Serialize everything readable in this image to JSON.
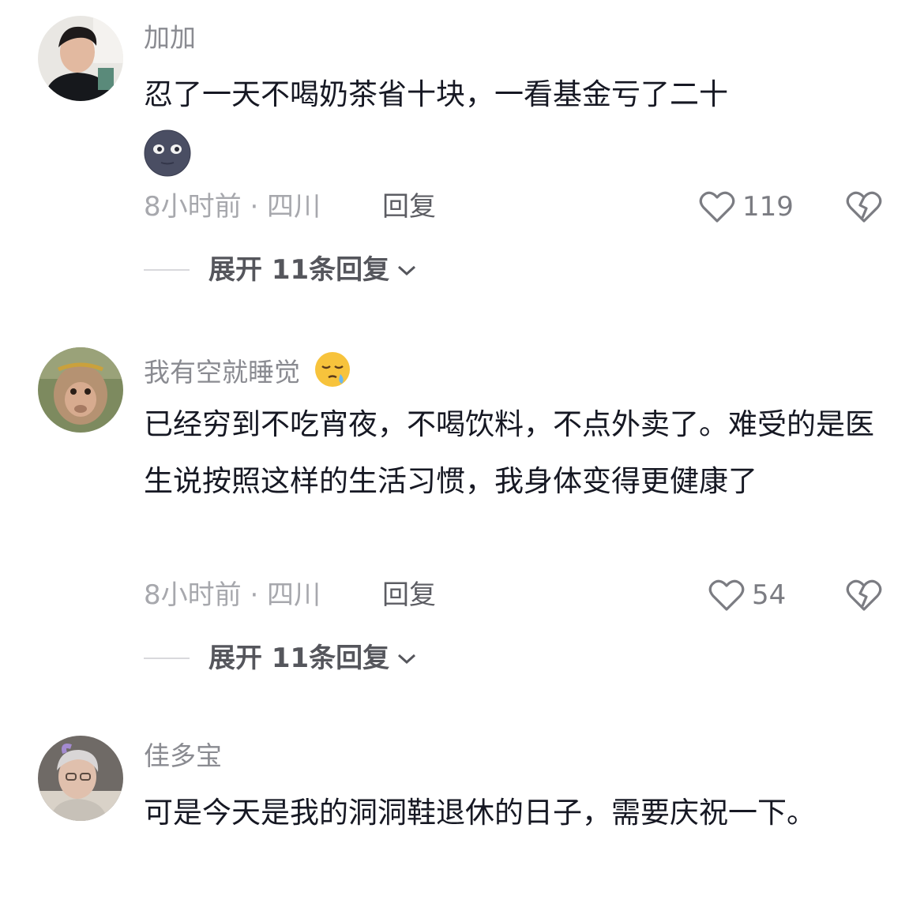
{
  "comments": [
    {
      "username": "加加",
      "text": "忍了一天不喝奶茶省十块，一看基金亏了二十",
      "text_emoji": "new-moon-face-emoji",
      "time_location": "8小时前 · 四川",
      "reply_label": "回复",
      "likes": "119",
      "expand_label": "展开 11条回复"
    },
    {
      "username": "我有空就睡觉",
      "name_emoji": "sleepy-face-emoji",
      "text": "已经穷到不吃宵夜，不喝饮料，不点外卖了。难受的是医生说按照这样的生活习惯，我身体变得更健康了",
      "time_location": "8小时前 · 四川",
      "reply_label": "回复",
      "likes": "54",
      "expand_label": "展开 11条回复"
    },
    {
      "username": "佳多宝",
      "text": "可是今天是我的洞洞鞋退休的日子，需要庆祝一下。"
    }
  ]
}
